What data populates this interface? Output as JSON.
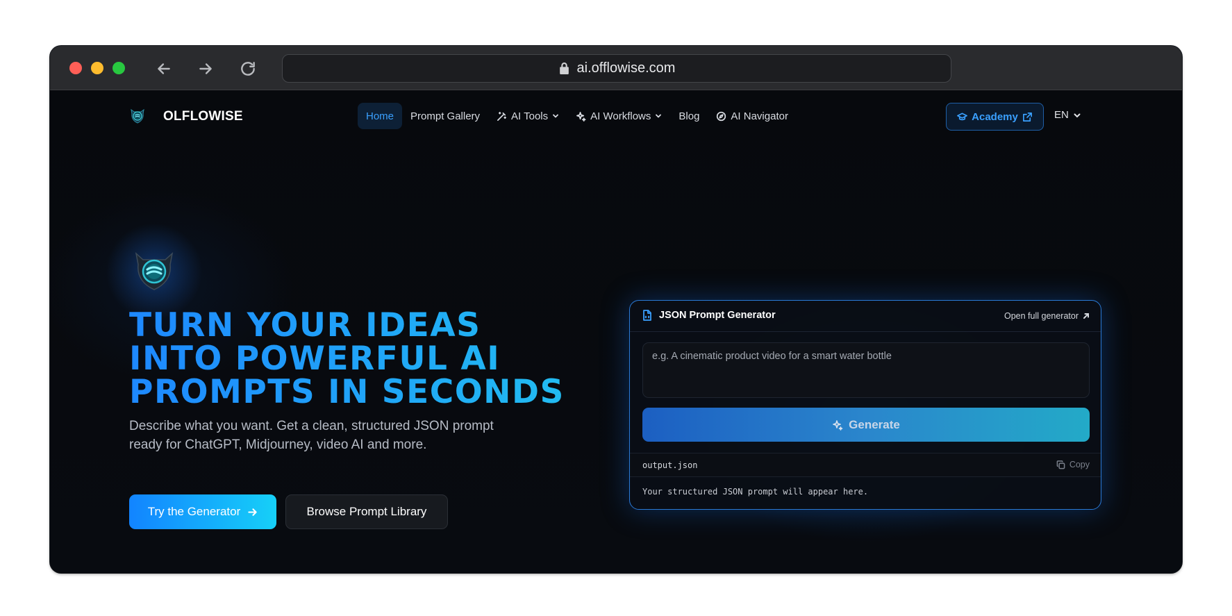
{
  "browser": {
    "url": "ai.offlowise.com",
    "icons": {
      "back": "arrow-left-icon",
      "forward": "arrow-right-icon",
      "reload": "reload-icon",
      "lock": "lock-icon"
    }
  },
  "nav": {
    "brand": "OLFLOWISE",
    "items": [
      {
        "label": "Home",
        "active": true
      },
      {
        "label": "Prompt Gallery"
      },
      {
        "label": "AI Tools",
        "icon": "wand-icon",
        "dropdown": true
      },
      {
        "label": "AI Workflows",
        "icon": "sparkle-icon",
        "dropdown": true
      },
      {
        "label": "Blog"
      },
      {
        "label": "AI Navigator",
        "icon": "compass-icon"
      }
    ],
    "academy": "Academy",
    "language": "EN"
  },
  "hero": {
    "headline_lines": [
      "TURN YOUR IDEAS",
      "INTO POWERFUL AI",
      "PROMPTS IN SECONDS"
    ],
    "subtext": "Describe what you want. Get a clean, structured JSON prompt ready for ChatGPT, Midjourney, video AI and more.",
    "cta_primary": "Try the Generator",
    "cta_secondary": "Browse Prompt Library"
  },
  "generator": {
    "title": "JSON Prompt Generator",
    "open_full": "Open full generator",
    "placeholder": "e.g. A cinematic product video for a smart water bottle",
    "generate_label": "Generate",
    "output_filename": "output.json",
    "copy_label": "Copy",
    "output_placeholder": "Your structured JSON prompt will appear here."
  },
  "colors": {
    "accent": "#3aa0ff",
    "headline_gradient_start": "#1e88ff",
    "headline_gradient_end": "#22c0f0",
    "background": "#07090d"
  }
}
